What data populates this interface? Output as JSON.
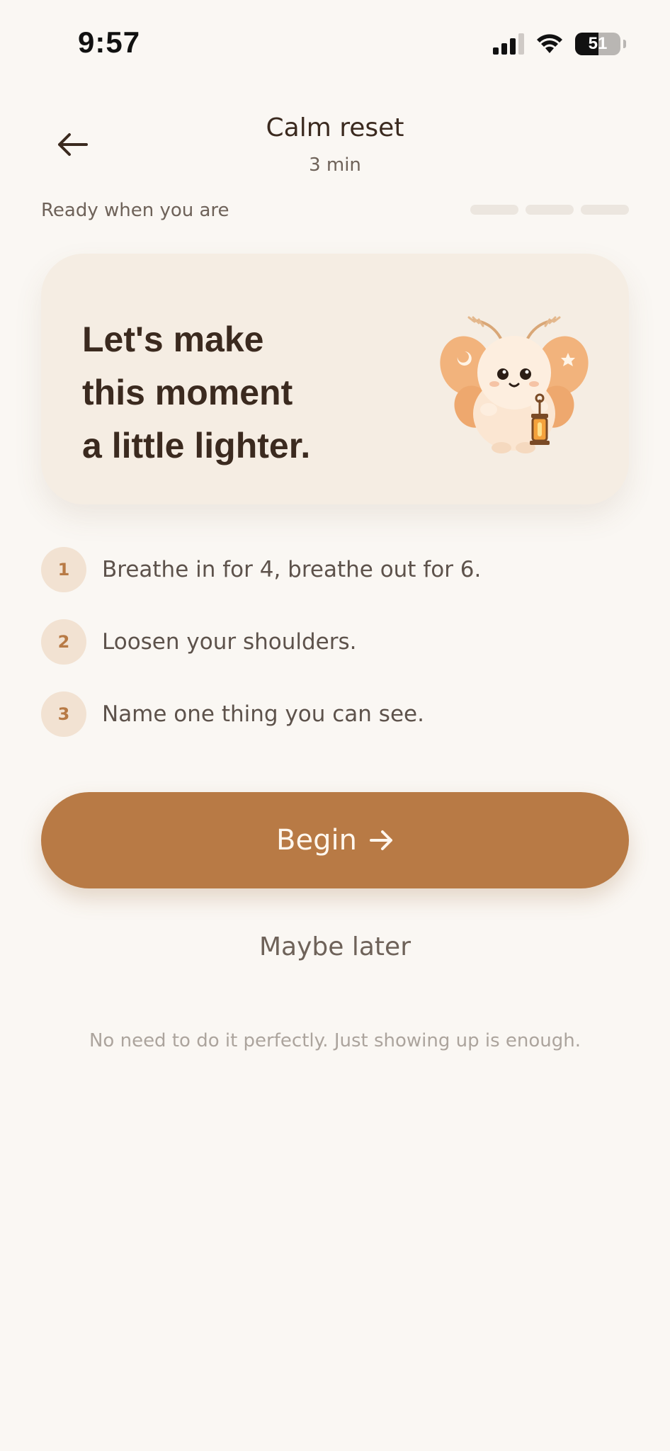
{
  "status_bar": {
    "time": "9:57",
    "battery_level": "51",
    "icons": [
      "signal-icon",
      "wifi-icon",
      "battery-icon"
    ]
  },
  "header": {
    "back_icon": "arrow-left-icon",
    "title": "Calm reset",
    "subtitle": "3 min"
  },
  "progress": {
    "label": "Ready when you are",
    "segments_total": 3,
    "segments_completed": 0
  },
  "hero": {
    "lines": [
      "Let's make",
      "this moment",
      "a little lighter."
    ],
    "mascot": "moth-mascot-with-lantern"
  },
  "steps": [
    {
      "number": "1",
      "text": "Breathe in for 4, breathe out for 6."
    },
    {
      "number": "2",
      "text": "Loosen your shoulders."
    },
    {
      "number": "3",
      "text": "Name one thing you can see."
    }
  ],
  "actions": {
    "begin_label": "Begin",
    "begin_icon": "arrow-right-icon",
    "later_label": "Maybe later"
  },
  "footer_note": "No need to do it perfectly. Just showing up is enough.",
  "colors": {
    "background": "#faf7f3",
    "accent": "#b87a45",
    "card": "#f5ede3",
    "step_badge": "#f2e2d2",
    "text_primary": "#3b2a1f",
    "text_secondary": "#6e6259"
  }
}
